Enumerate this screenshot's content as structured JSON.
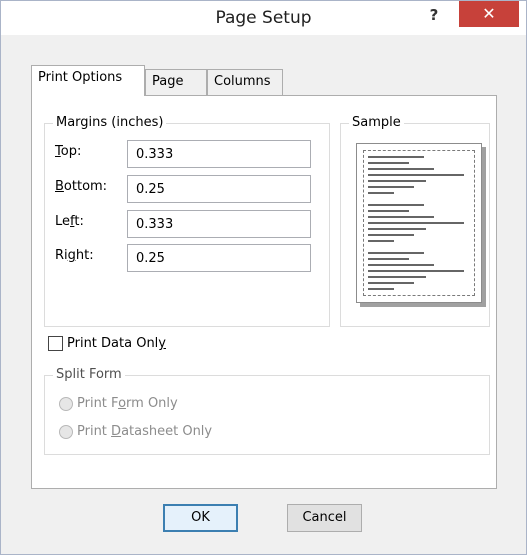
{
  "window": {
    "title": "Page Setup",
    "help_label": "?",
    "close_label": "✕"
  },
  "tabs": [
    {
      "label": "Print Options"
    },
    {
      "label": "Page"
    },
    {
      "label": "Columns"
    }
  ],
  "margins": {
    "group_label": "Margins (inches)",
    "top": {
      "label_prefix": "",
      "label_key": "T",
      "label_rest": "op:",
      "value": "0.333"
    },
    "bottom": {
      "label_prefix": "",
      "label_key": "B",
      "label_rest": "ottom:",
      "value": "0.25"
    },
    "left": {
      "label_prefix": "Le",
      "label_key": "f",
      "label_rest": "t:",
      "value": "0.333"
    },
    "right": {
      "label_prefix": "Ri",
      "label_key": "g",
      "label_rest": "ht:",
      "value": "0.25"
    }
  },
  "sample": {
    "group_label": "Sample"
  },
  "print_data_only": {
    "label_prefix": "Print Data Onl",
    "label_key": "y",
    "checked": false
  },
  "split_form": {
    "group_label": "Split Form",
    "options": [
      {
        "label_prefix": "Print F",
        "label_key": "o",
        "label_rest": "rm Only"
      },
      {
        "label_prefix": "Print ",
        "label_key": "D",
        "label_rest": "atasheet Only"
      }
    ]
  },
  "buttons": {
    "ok_label": "OK",
    "cancel_label": "Cancel"
  }
}
